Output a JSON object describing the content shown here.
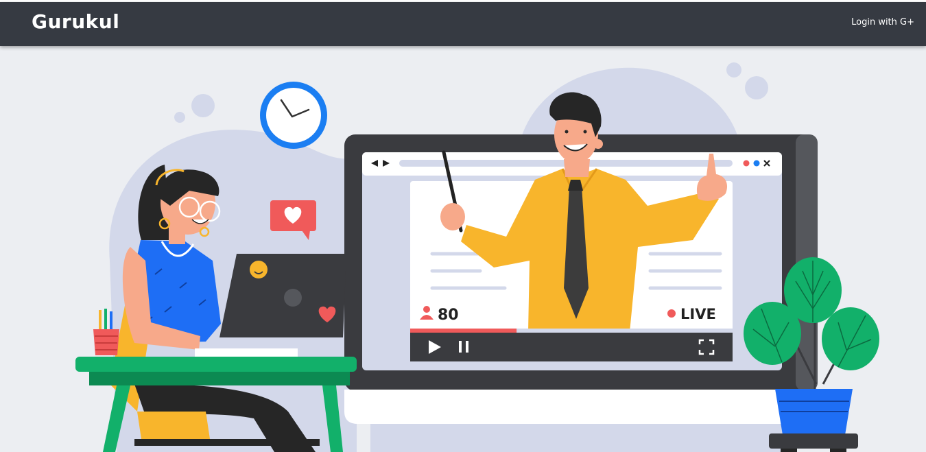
{
  "navbar": {
    "brand": "Gurukul",
    "login_label": "Login with G+"
  },
  "hero": {
    "illustration": "online-class-illustration",
    "viewer_count": "80",
    "live_label": "LIVE",
    "video_progress": 0.33,
    "colors": {
      "background": "#eceef2",
      "blob": "#d3d8ea",
      "monitor": "#3a3b3f",
      "accent_red": "#f05a5a",
      "accent_blue": "#1b7ef2",
      "green": "#12b06a",
      "teacher_shirt": "#f8b52c",
      "student_top": "#1e6ef5"
    }
  }
}
